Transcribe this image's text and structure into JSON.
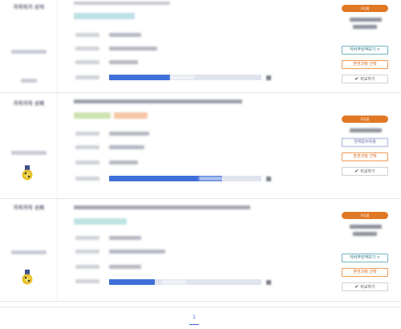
{
  "courses": [
    {
      "logo_text": "가지치기 산지",
      "badge": "모집중",
      "buttons": {
        "cost": "자비부담액보기 >",
        "select": "훈련과정 선택",
        "compare": "비교하기"
      }
    },
    {
      "logo_text": "가지가지 신뢰",
      "badge": "모집중",
      "buttons": {
        "cost": "전체일부비용",
        "select": "훈련과정 선택",
        "compare": "비교하기"
      }
    },
    {
      "logo_text": "가지가지 신뢰",
      "badge": "모집중",
      "buttons": {
        "cost": "자비부담액보기 >",
        "select": "훈련과정 선택",
        "compare": "비교하기"
      }
    }
  ],
  "pager": {
    "current": "1"
  },
  "colors": {
    "badge": "#e07824",
    "bar_fill": "#3f6fd8",
    "bar_track": "#dfe4ef",
    "cost_button": "#6fb4c4",
    "select_button": "#ef9a56",
    "current_page": "#3a66d4"
  },
  "icons": {
    "compare": "check-icon",
    "award": "gold-badge-icon"
  }
}
